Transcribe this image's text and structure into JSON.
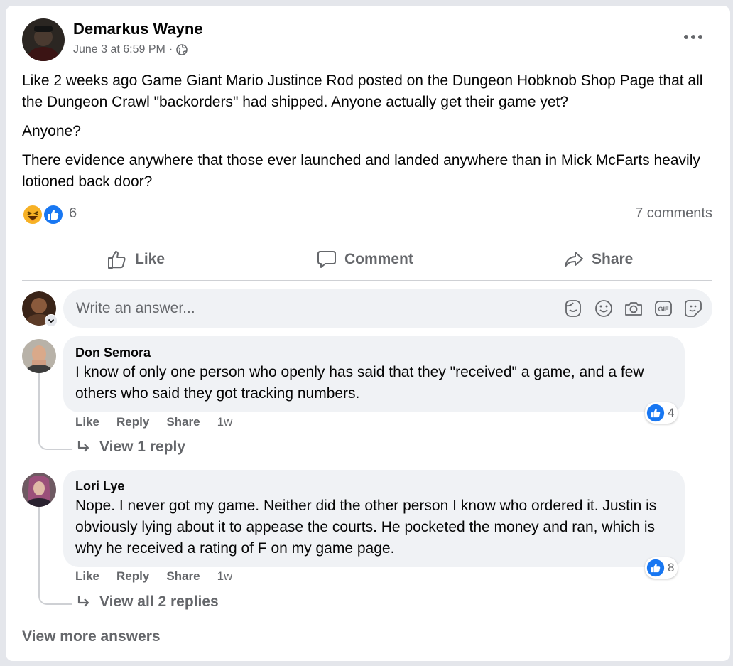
{
  "post": {
    "author": "Demarkus Wayne",
    "timestamp": "June 3 at 6:59 PM",
    "separator": "·",
    "audience_icon": "globe-icon",
    "paragraphs": [
      "Like 2 weeks ago Game Giant Mario Justince Rod posted on the Dungeon Hobknob Shop Page that all the Dungeon Crawl \"backorders\" had shipped. Anyone actually get their game yet?",
      "Anyone?",
      "There evidence anywhere that those ever launched and landed anywhere than in Mick McFarts heavily lotioned back door?"
    ],
    "reactions": {
      "icons": [
        "haha-icon",
        "like-icon"
      ],
      "count": "6"
    },
    "comments_count": "7 comments"
  },
  "actions": {
    "like": "Like",
    "comment": "Comment",
    "share": "Share"
  },
  "composer": {
    "placeholder": "Write an answer...",
    "tools": [
      "avatar-sticker-icon",
      "emoji-icon",
      "camera-icon",
      "gif-icon",
      "sticker-icon"
    ]
  },
  "comments": [
    {
      "author": "Don Semora",
      "text": "I know of only one person who openly has said that they \"received\" a game, and a few others who said they got tracking numbers.",
      "like": "Like",
      "reply": "Reply",
      "share": "Share",
      "time": "1w",
      "reaction_count": "4",
      "replies_link": "View 1 reply"
    },
    {
      "author": "Lori Lye",
      "text": "Nope. I never got my game. Neither did the other person I know who ordered it. Justin is obviously lying about it to appease the courts. He pocketed the money and ran, which is why he received a rating of F on my game page.",
      "like": "Like",
      "reply": "Reply",
      "share": "Share",
      "time": "1w",
      "reaction_count": "8",
      "replies_link": "View all 2 replies"
    }
  ],
  "footer": {
    "more_answers": "View more answers"
  },
  "colors": {
    "like_blue": "#1877f2",
    "haha_yellow": "#f7b125",
    "secondary_text": "#65676b",
    "bubble_bg": "#f0f2f5"
  }
}
